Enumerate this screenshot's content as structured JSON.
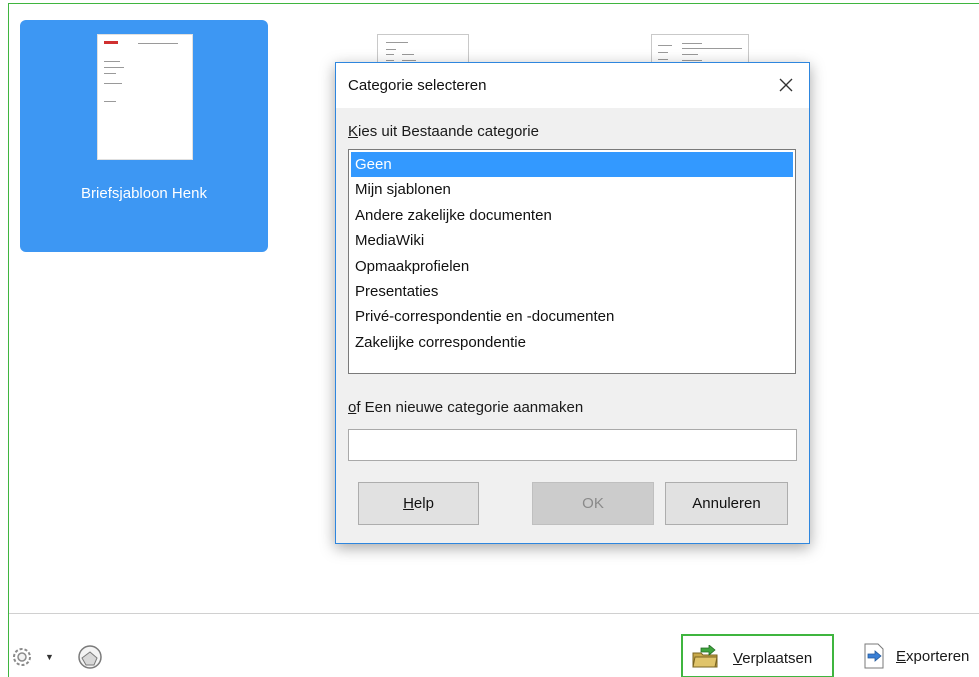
{
  "templates": [
    {
      "label": "Briefsjabloon Henk",
      "selected": true
    }
  ],
  "dialog": {
    "title": "Categorie selecteren",
    "existing_label": "Kies uit Bestaande categorie",
    "categories": [
      "Geen",
      "Mijn sjablonen",
      "Andere zakelijke documenten",
      "MediaWiki",
      "Opmaakprofielen",
      "Presentaties",
      "Privé-correspondentie en -documenten",
      "Zakelijke correspondentie"
    ],
    "selected_category": "Geen",
    "new_label": "of Een nieuwe categorie aanmaken",
    "new_value": "",
    "help_label": "Help",
    "ok_label": "OK",
    "cancel_label": "Annuleren"
  },
  "toolbar": {
    "move_label": "Verplaatsen",
    "export_label": "Exporteren"
  },
  "colors": {
    "selection": "#3d97f3",
    "list_selection": "#3399ff",
    "highlight_border": "#3fb53f",
    "dialog_border": "#2e86de"
  },
  "icons": [
    "gear-icon",
    "chevron-down-icon",
    "globe-icon",
    "move-folder-icon",
    "export-icon",
    "close-icon"
  ]
}
